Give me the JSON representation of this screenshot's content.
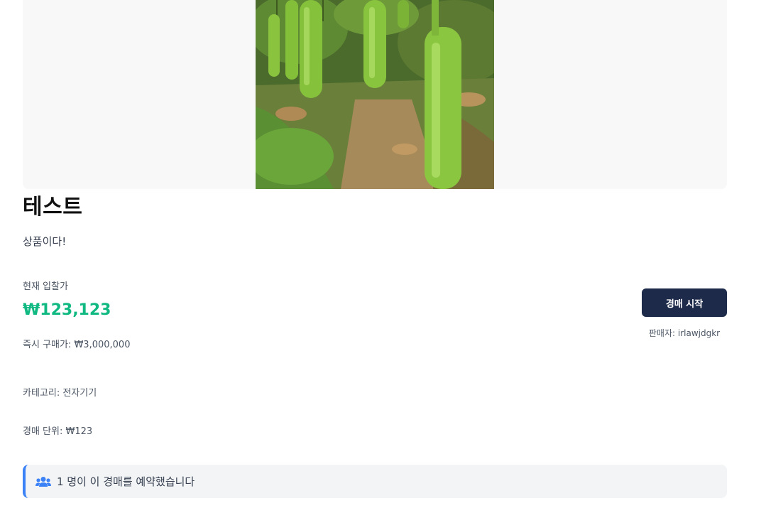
{
  "product": {
    "title": "테스트",
    "description": "상품이다!",
    "image_icon": "bottle-gourd-photo"
  },
  "bidding": {
    "current_bid_label": "현재 입찰가",
    "current_bid_value": "₩123,123",
    "buy_now": "즉시 구매가: ₩3,000,000",
    "category": "카테고리: 전자기기",
    "bid_unit": "경매 단위: ₩123"
  },
  "actions": {
    "start_auction_label": "경매 시작",
    "seller": "판매자: irlawjdgkr"
  },
  "reservation": {
    "icon": "users-icon",
    "text": "1 명이 이 경매를 예약했습니다"
  },
  "colors": {
    "price": "#10b981",
    "primary_button": "#1e2a4a",
    "accent_border": "#3b82f6"
  }
}
